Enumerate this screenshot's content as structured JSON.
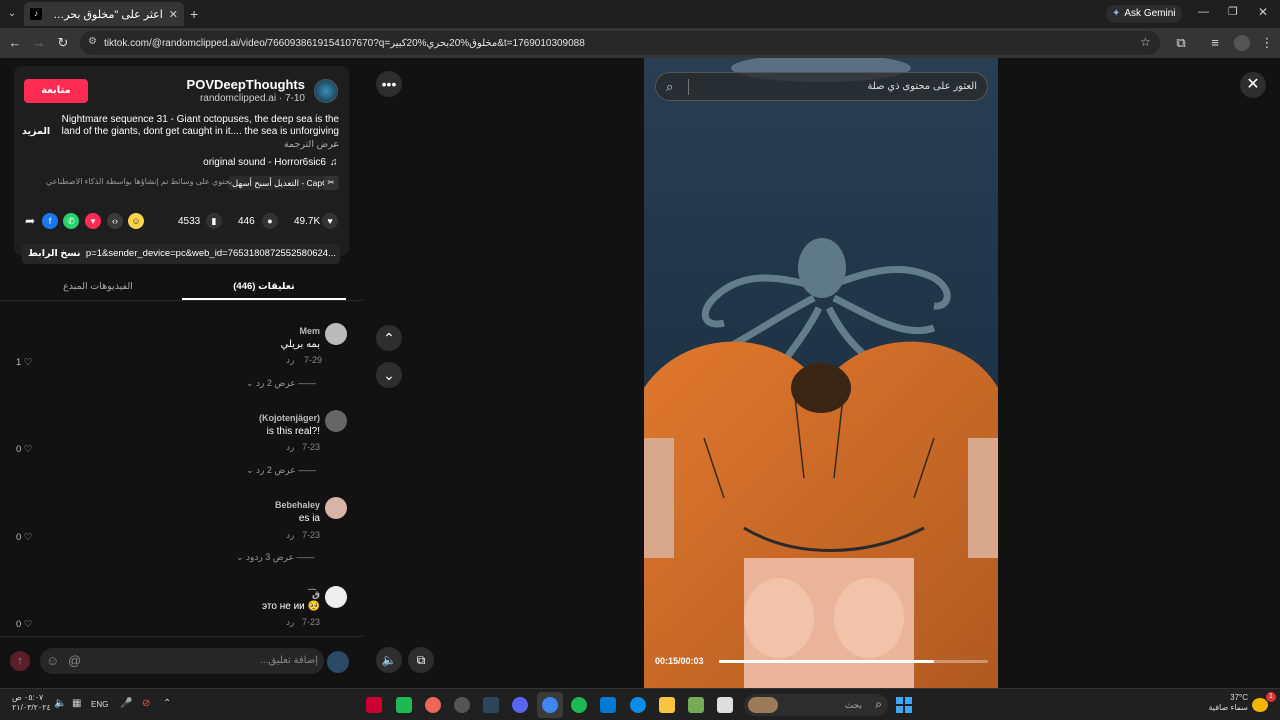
{
  "browser": {
    "tab_title": "اعثر على \"مخلوق بحري كبير\"",
    "url": "tiktok.com/@randomclipped.ai/video/7660938619154107670?q=مخلوق%20بحري%20كبير&t=1769010309088",
    "ask_gemini": "Ask Gemini"
  },
  "post": {
    "username": "POVDeepThoughts",
    "handle_line": "randomclipped.ai · 7-10",
    "follow_label": "متابعة",
    "caption": "Nightmare sequence 31 - Giant octopuses, the deep sea is the land of the giants, dont get caught in it.... the sea is unforgiving ...",
    "more_label": "المزيد",
    "translate_label": "عرض الترجمة",
    "sound": "original sound - Horror6sic6",
    "capcut_label": "CapCut - التعديل أسبح أسهل",
    "ai_notice": "يحتوي على وسائط تم إنشاؤها بواسطة الذكاء الاصطناعي",
    "likes": "49.7K",
    "comments_count": "446",
    "saves": "4533",
    "link_text": "p=1&sender_device=pc&web_id=7653180872552580624...",
    "copy_link_label": "نسخ الرابط"
  },
  "tabs": {
    "comments": "تعليقات (446)",
    "creator_videos": "الفيديوهات المبدع"
  },
  "comments": [
    {
      "user": "Mem",
      "text": "بمه بريلي",
      "date": "7-29",
      "reply": "رد",
      "likes": "1",
      "replies": "عرض 2 رد"
    },
    {
      "user": "(Kojotenjäger)",
      "text": "is this real?!",
      "date": "7-23",
      "reply": "رد",
      "likes": "0",
      "replies": "عرض 2 رد"
    },
    {
      "user": "Bebehaley",
      "text": "es ia",
      "date": "7-23",
      "reply": "رد",
      "likes": "0",
      "replies": "عرض 3 ردود"
    },
    {
      "user": "ق͡",
      "text": "это не ии 🥺",
      "date": "7-23",
      "reply": "رد",
      "likes": "0",
      "replies": ""
    }
  ],
  "comment_input": {
    "placeholder": "إضافة تعليق..."
  },
  "video": {
    "search_placeholder": "العثور على محتوى ذي صلة",
    "time": "00:15/00:03",
    "progress": 0.8
  },
  "taskbar": {
    "search_placeholder": "بحث",
    "lang": "ENG",
    "time": "٠٥:٠٧ ص",
    "date": "٢١/٠٣/٢٠٢٤",
    "weather_temp": "37°C",
    "weather_desc": "سماء صافية"
  },
  "colors": {
    "accent": "#fe2c55",
    "bg": "#121212"
  }
}
